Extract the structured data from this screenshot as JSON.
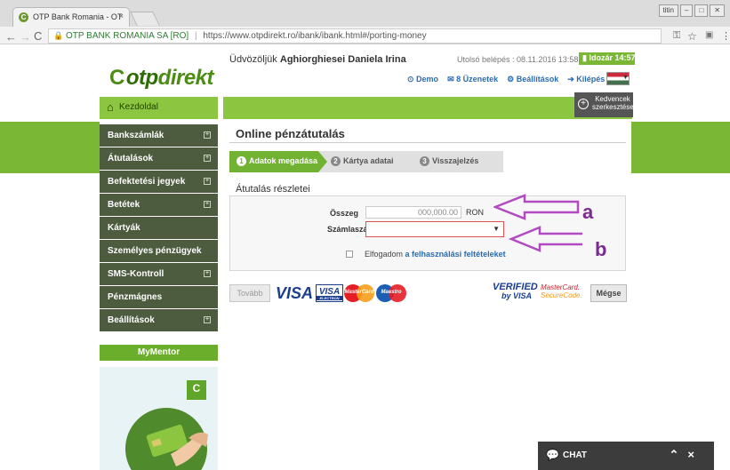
{
  "browser": {
    "tab_title": "OTP Bank Romania - OT",
    "tab_favicon": "C",
    "tab_close": "×",
    "window_user": "titin",
    "url_site": "OTP BANK ROMANIA SA [RO]",
    "url_path": "https://www.otpdirekt.ro/ibank/ibank.html#/porting-money"
  },
  "header": {
    "logo_otp": "otp",
    "logo_direkt": "direkt",
    "welcome_prefix": "Üdvözöljük",
    "user_name": "Aghiorghiesei Daniela Irina",
    "last_login": "Utolsó belépés : 08.11.2016 13:58:10",
    "timer": "Idozár 14:57",
    "links": {
      "demo": "Demo",
      "messages": "8 Üzenetek",
      "settings": "Beállítások",
      "logout": "Kilépés"
    }
  },
  "home_label": "Kezdoldal",
  "favorites_label": "Kedvencek szerkesztése",
  "sidebar": {
    "items": [
      {
        "label": "Bankszámlák",
        "expand": "+"
      },
      {
        "label": "Átutalások",
        "expand": "+"
      },
      {
        "label": "Befektetési jegyek",
        "expand": "+"
      },
      {
        "label": "Betétek",
        "expand": "+"
      },
      {
        "label": "Kártyák",
        "expand": ""
      },
      {
        "label": "Személyes pénzügyek",
        "expand": ""
      },
      {
        "label": "SMS-Kontroll",
        "expand": "+"
      },
      {
        "label": "Pénzmágnes",
        "expand": ""
      },
      {
        "label": "Beállítások",
        "expand": "+"
      }
    ],
    "mymentor": "MyMentor"
  },
  "main": {
    "title": "Online pénzátutalás",
    "steps": [
      {
        "num": "1",
        "label": "Adatok megadása"
      },
      {
        "num": "2",
        "label": "Kártya adatai"
      },
      {
        "num": "3",
        "label": "Visszajelzés"
      }
    ],
    "section_title": "Átutalás részletei",
    "amount_label": "Összeg",
    "amount_value": "000,000.00",
    "currency": "RON",
    "account_label": "Számlaszám",
    "account_value": "",
    "terms_prefix": "Elfogadom",
    "terms_link": "a felhasználási feltételeket",
    "next_button": "Tovább",
    "cancel_button": "Mégse"
  },
  "logos": {
    "visa": "VISA",
    "visa_electron_label": "VISA",
    "visa_electron_sub": "ELECTRON",
    "mastercard": "MasterCard",
    "maestro": "Maestro",
    "vbv_top": "VERIFIED",
    "vbv_bottom": "by VISA",
    "mcsc_top": "MasterCard.",
    "mcsc_bottom": "SecureCode."
  },
  "annotations": {
    "a": "a",
    "b": "b",
    "color": "#7a2b8e"
  },
  "chat": {
    "label": "CHAT"
  },
  "colors": {
    "brand_green": "#7ab735",
    "sidebar_dark": "#4d5b3f",
    "link_blue": "#2a6cb0"
  }
}
